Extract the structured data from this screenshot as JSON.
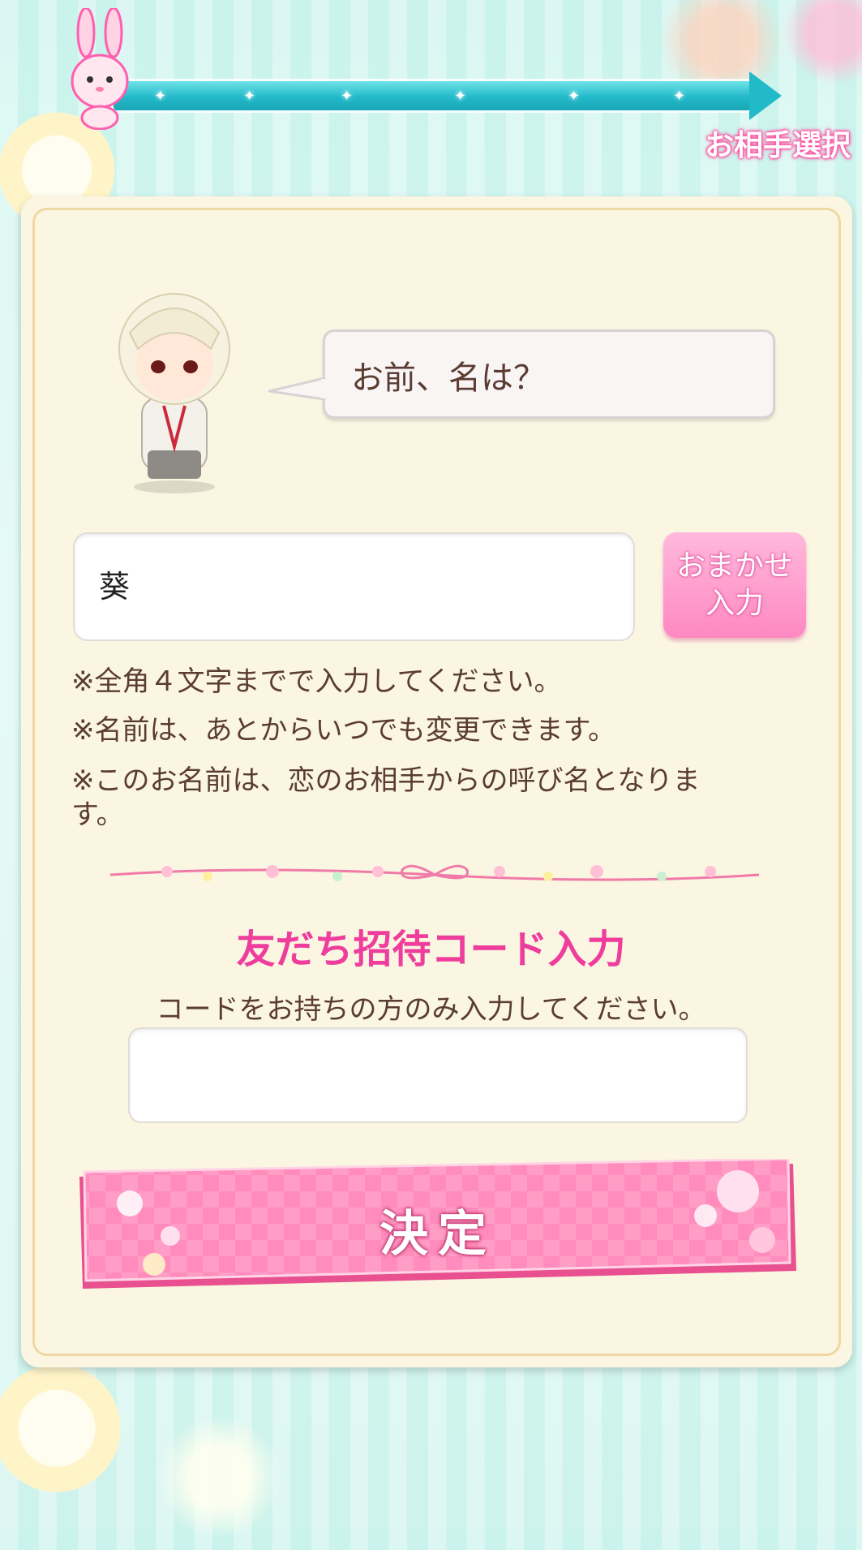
{
  "header": {
    "step_label": "お相手選択"
  },
  "speech": {
    "text": "お前、名は？"
  },
  "name_field": {
    "value": "葵"
  },
  "random_button": {
    "line1": "おまかせ",
    "line2": "入力"
  },
  "notes": [
    "※全角４文字までで入力してください。",
    "※名前は、あとからいつでも変更できます。",
    "※このお名前は、恋のお相手からの呼び名となりま",
    "す。"
  ],
  "invite": {
    "title": "友だち招待コード入力",
    "subtitle": "コードをお持ちの方のみ入力してください。",
    "value": ""
  },
  "submit": {
    "label": "決定"
  },
  "colors": {
    "accent_pink": "#ee3d9c",
    "progress_teal": "#22b9c9",
    "card_bg": "#fbf6e2",
    "text_brown": "#5a3c32"
  },
  "icons": {
    "mascot": "rabbit-mascot-icon",
    "character": "chibi-character-icon",
    "divider": "ribbon-flower-divider-icon"
  }
}
